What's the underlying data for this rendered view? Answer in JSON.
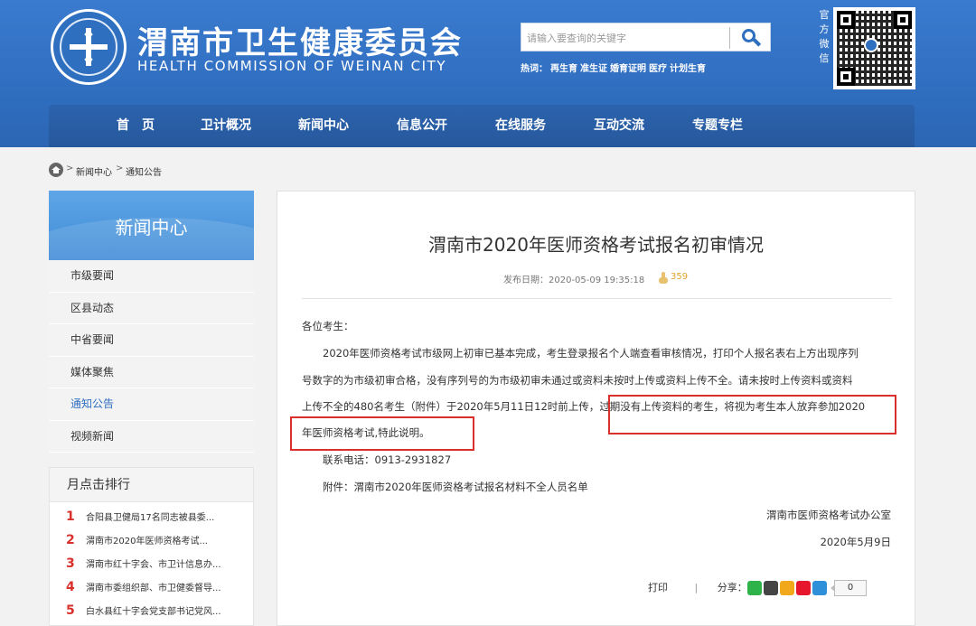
{
  "header": {
    "title": "渭南市卫生健康委员会",
    "subtitle": "HEALTH COMMISSION OF WEINAN CITY",
    "search_placeholder": "请输入要查询的关键字",
    "hot_label": "热词：",
    "hot_words": [
      "再生育",
      "准生证",
      "婚育证明",
      "医疗",
      "计划生育"
    ],
    "wechat_label": "官方微信",
    "brand_color": "#2f6fc0"
  },
  "nav": [
    "首　页",
    "卫计概况",
    "新闻中心",
    "信息公开",
    "在线服务",
    "互动交流",
    "专题专栏"
  ],
  "breadcrumb": {
    "items": [
      "新闻中心",
      "通知公告"
    ],
    "separator": ">"
  },
  "sidebar": {
    "title": "新闻中心",
    "items": [
      "市级要闻",
      "区县动态",
      "中省要闻",
      "媒体聚焦",
      "通知公告",
      "视频新闻"
    ],
    "active": "通知公告",
    "rank_title": "月点击排行",
    "rank_items": [
      {
        "num": "1",
        "text": "合阳县卫健局17名同志被县委..."
      },
      {
        "num": "2",
        "text": "渭南市2020年医师资格考试..."
      },
      {
        "num": "3",
        "text": "渭南市红十字会、市卫计信息办..."
      },
      {
        "num": "4",
        "text": "渭南市委组织部、市卫健委督导..."
      },
      {
        "num": "5",
        "text": "白水县红十字会党支部书记党风..."
      }
    ]
  },
  "article": {
    "title": "渭南市2020年医师资格考试报名初审情况",
    "publish_label": "发布日期：2020-05-09 19:35:18",
    "views": "359",
    "salutation": "各位考生：",
    "body_line1": "2020年医师资格考试市级网上初审已基本完成，考生登录报名个人端查看审核情况，打印个人报名表右上方出现序列",
    "body_line2": "号数字的为市级初审合格，没有序列号的为市级初审未通过或资料未按时上传或资料上传不全。请未按时上传资料或资料",
    "body_line3a": "上传不全的480名考生（附件）于2020年5月11日12时前上传，",
    "body_line3b": "过期没有上传资料的考生，将视为考生本人放弃参加2020",
    "body_line4": "年医师资格考试,特此说明。",
    "contact": "联系电话：0913-2931827",
    "attachment": "附件：渭南市2020年医师资格考试报名材料不全人员名单",
    "signer": "渭南市医师资格考试办公室",
    "sign_date": "2020年5月9日",
    "print_label": "打印",
    "share_label": "分享：",
    "share_count": "0",
    "highlight_color": "#d9302b"
  }
}
